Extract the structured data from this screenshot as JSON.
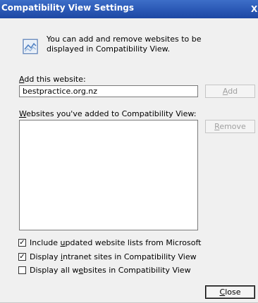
{
  "window": {
    "title": "Compatibility View Settings",
    "close_glyph": "X"
  },
  "info": {
    "icon": "compatibility-view-icon",
    "text": "You can add and remove websites to be displayed in Compatibility View."
  },
  "add_site": {
    "label_access": "A",
    "label_rest": "dd this website:",
    "value": "bestpractice.org.nz",
    "button_access": "A",
    "button_rest": "dd"
  },
  "sites_list": {
    "label_access": "W",
    "label_rest": "ebsites you've added to Compatibility View:",
    "items": [],
    "remove_access": "R",
    "remove_rest": "emove"
  },
  "options": [
    {
      "pre": "Include ",
      "access": "u",
      "post": "pdated website lists from Microsoft",
      "checked": true
    },
    {
      "pre": "Display ",
      "access": "i",
      "post": "ntranet sites in Compatibility View",
      "checked": true
    },
    {
      "pre": "Display all w",
      "access": "e",
      "post": "bsites in Compatibility View",
      "checked": false
    }
  ],
  "close_button": {
    "access": "C",
    "rest": "lose"
  }
}
